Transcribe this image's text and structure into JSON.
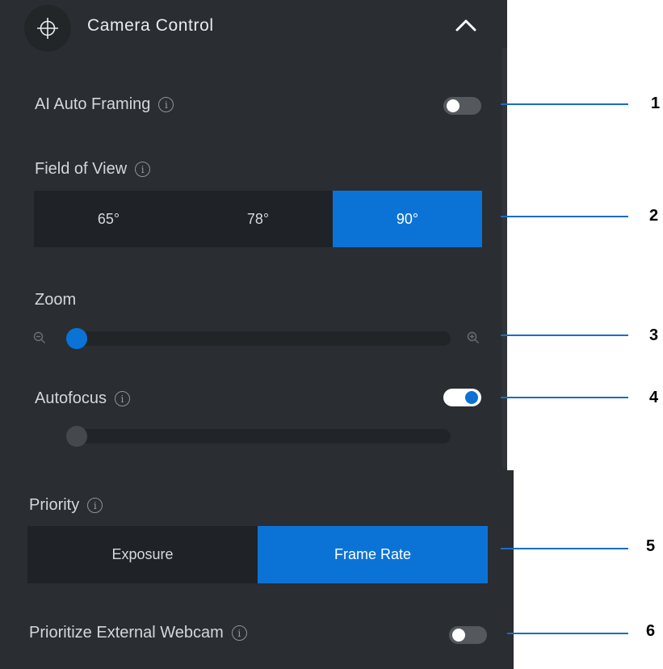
{
  "header": {
    "title": "Camera Control",
    "icon": "crosshair-icon",
    "collapse_icon": "chevron-up-icon"
  },
  "ai_auto_framing": {
    "label": "AI Auto Framing",
    "enabled": false
  },
  "field_of_view": {
    "label": "Field of View",
    "options": [
      "65°",
      "78°",
      "90°"
    ],
    "selected": "90°"
  },
  "zoom": {
    "label": "Zoom",
    "value": 0,
    "zoom_out_icon": "zoom-out-icon",
    "zoom_in_icon": "zoom-in-icon"
  },
  "autofocus": {
    "label": "Autofocus",
    "enabled": true,
    "focus_slider_value": 0
  },
  "priority": {
    "label": "Priority",
    "options": [
      "Exposure",
      "Frame Rate"
    ],
    "selected": "Frame Rate"
  },
  "prioritize_external_webcam": {
    "label": "Prioritize External Webcam",
    "enabled": false
  },
  "callouts": [
    "1",
    "2",
    "3",
    "4",
    "5",
    "6"
  ],
  "colors": {
    "panel_bg": "#2a2d31",
    "accent": "#0b73d6",
    "callout_line": "#1a6cc9"
  }
}
